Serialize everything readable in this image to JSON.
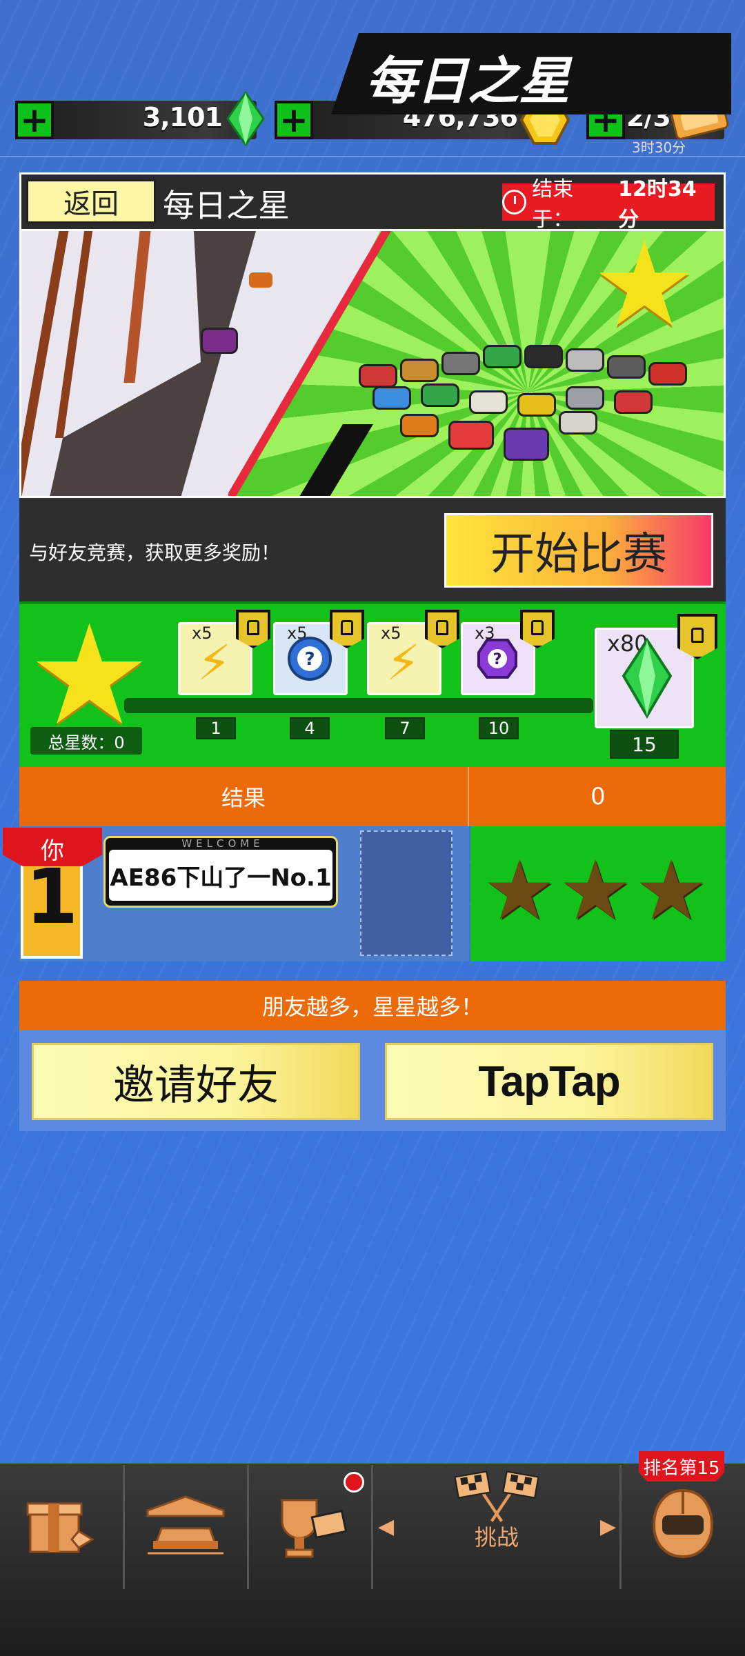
{
  "currency": {
    "gems": "3,101",
    "coins": "476,736",
    "tickets": "2/3",
    "ticket_timer": "3时30分",
    "plus": "+"
  },
  "header": {
    "back_label": "返回",
    "title": "每日之星",
    "timer_label": "结束于：",
    "timer_value": "12时34分"
  },
  "banner": {
    "title": "每日之星"
  },
  "race": {
    "prompt": "与好友竞赛，获取更多奖励！",
    "start_label": "开始比赛"
  },
  "rewards": {
    "total_stars": "总星数：0",
    "items": [
      {
        "multiplier": "x5",
        "type": "lightning-icon",
        "level": "1"
      },
      {
        "multiplier": "x5",
        "type": "mystery-box-icon",
        "level": "4"
      },
      {
        "multiplier": "x5",
        "type": "lightning-icon",
        "level": "7"
      },
      {
        "multiplier": "x3",
        "type": "mystery-gem-icon",
        "level": "10"
      },
      {
        "multiplier": "x80",
        "type": "gem-icon",
        "level": "15"
      }
    ]
  },
  "result": {
    "label": "结果",
    "value": "0",
    "you_label": "你",
    "rank": "1",
    "plate_header": "WELCOME",
    "player_name": "AE86下山了一No.1"
  },
  "friends": {
    "banner": "朋友越多，星星越多！",
    "invite_label": "邀请好友",
    "taptap_label": "TapTap"
  },
  "nav": {
    "items": [
      {
        "icon": "shop-icon"
      },
      {
        "icon": "garage-icon"
      },
      {
        "icon": "trophy-icon"
      },
      {
        "icon": "checkered-flags-icon",
        "label": "挑战"
      },
      {
        "icon": "helmet-icon",
        "badge": "排名第15"
      }
    ]
  },
  "colors": {
    "background": "#3d73d6",
    "accent_orange": "#ec6a07",
    "accent_green": "#12c21b",
    "alert_red": "#e81a22"
  }
}
